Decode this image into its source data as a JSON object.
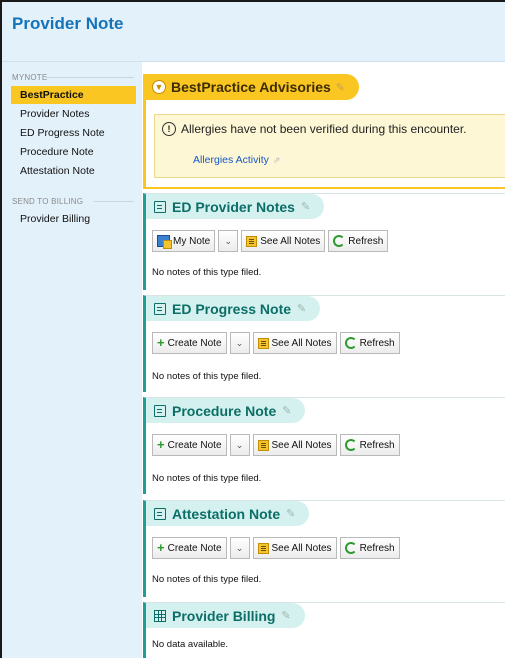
{
  "header": {
    "title": "Provider Note"
  },
  "sidebar": {
    "groups": [
      {
        "label": "MyNote",
        "items": [
          {
            "label": "BestPractice",
            "active": true
          },
          {
            "label": "Provider Notes",
            "active": false
          },
          {
            "label": "ED Progress Note",
            "active": false
          },
          {
            "label": "Procedure Note",
            "active": false
          },
          {
            "label": "Attestation Note",
            "active": false
          }
        ]
      },
      {
        "label": "Send To Billing",
        "items": [
          {
            "label": "Provider Billing",
            "active": false
          }
        ]
      }
    ]
  },
  "bpa": {
    "title": "BestPractice Advisories",
    "advisory_text": "Allergies have not been verified during this encounter.",
    "link_label": "Allergies Activity"
  },
  "sections": {
    "ed_provider_notes": {
      "title": "ED Provider Notes",
      "buttons": {
        "primary": "My Note",
        "see_all": "See All Notes",
        "refresh": "Refresh"
      },
      "empty": "No notes of this type filed."
    },
    "ed_progress_note": {
      "title": "ED Progress Note",
      "buttons": {
        "primary": "Create Note",
        "see_all": "See All Notes",
        "refresh": "Refresh"
      },
      "empty": "No notes of this type filed."
    },
    "procedure_note": {
      "title": "Procedure Note",
      "buttons": {
        "primary": "Create Note",
        "see_all": "See All Notes",
        "refresh": "Refresh"
      },
      "empty": "No notes of this type filed."
    },
    "attestation_note": {
      "title": "Attestation Note",
      "buttons": {
        "primary": "Create Note",
        "see_all": "See All Notes",
        "refresh": "Refresh"
      },
      "empty": "No notes of this type filed."
    },
    "provider_billing": {
      "title": "Provider Billing",
      "empty": "No data available."
    }
  },
  "colors": {
    "accent_teal": "#1f9e93",
    "bpa_yellow": "#f9c622",
    "header_blue": "#1573b8",
    "link_blue": "#1458c8"
  },
  "icons": {
    "edit": "pencil-icon",
    "note": "note-icon",
    "billing": "grid-icon",
    "refresh": "refresh-icon",
    "create": "plus-icon"
  }
}
